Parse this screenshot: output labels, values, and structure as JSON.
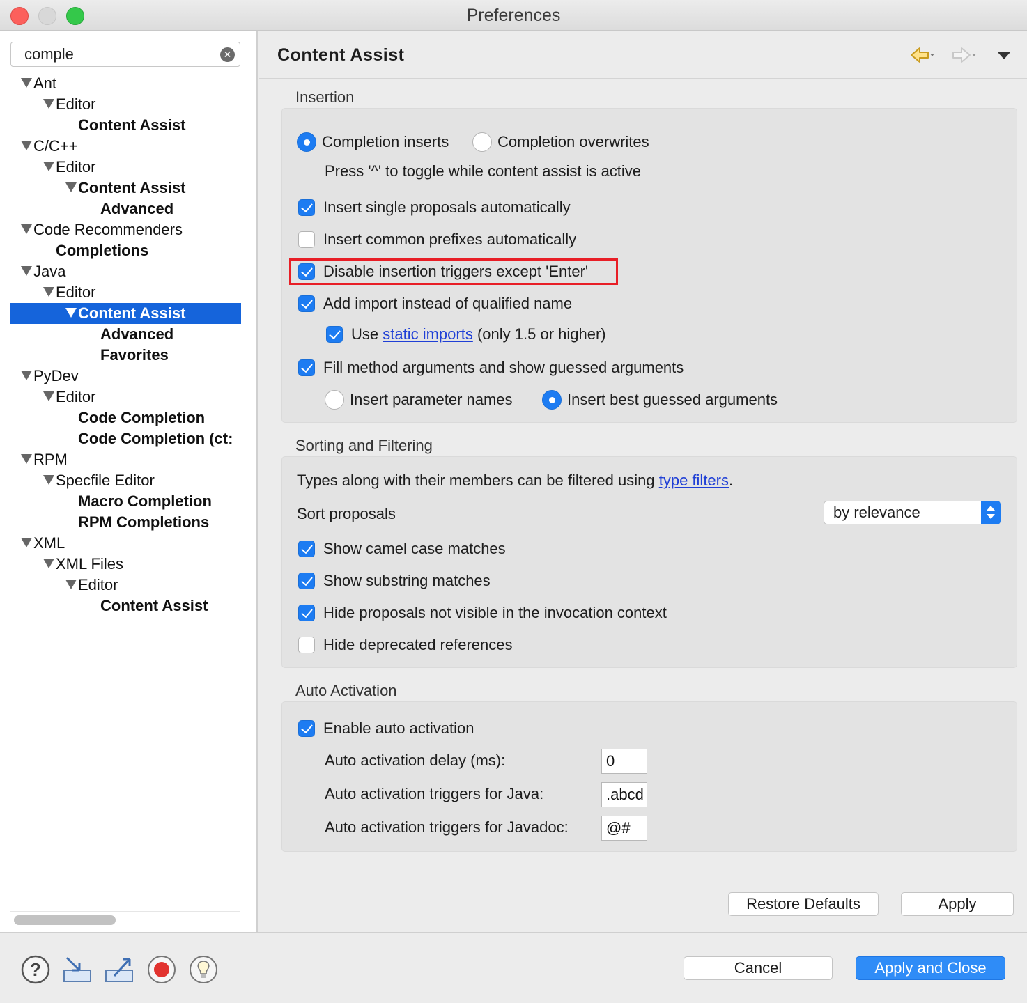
{
  "window": {
    "title": "Preferences"
  },
  "search": {
    "value": "comple",
    "clear_icon": "✕"
  },
  "tree": [
    {
      "label": "Ant",
      "bold": false,
      "expander": true,
      "selected": false
    },
    {
      "label": "Editor",
      "bold": false,
      "expander": true,
      "selected": false
    },
    {
      "label": "Content Assist",
      "bold": true,
      "expander": false,
      "selected": false
    },
    {
      "label": "C/C++",
      "bold": false,
      "expander": true,
      "selected": false
    },
    {
      "label": "Editor",
      "bold": false,
      "expander": true,
      "selected": false
    },
    {
      "label": "Content Assist",
      "bold": true,
      "expander": true,
      "selected": false
    },
    {
      "label": "Advanced",
      "bold": true,
      "expander": false,
      "selected": false
    },
    {
      "label": "Code Recommenders",
      "bold": false,
      "expander": true,
      "selected": false
    },
    {
      "label": "Completions",
      "bold": true,
      "expander": false,
      "selected": false
    },
    {
      "label": "Java",
      "bold": false,
      "expander": true,
      "selected": false
    },
    {
      "label": "Editor",
      "bold": false,
      "expander": true,
      "selected": false
    },
    {
      "label": "Content Assist",
      "bold": true,
      "expander": true,
      "selected": true
    },
    {
      "label": "Advanced",
      "bold": true,
      "expander": false,
      "selected": false
    },
    {
      "label": "Favorites",
      "bold": true,
      "expander": false,
      "selected": false
    },
    {
      "label": "PyDev",
      "bold": false,
      "expander": true,
      "selected": false
    },
    {
      "label": "Editor",
      "bold": false,
      "expander": true,
      "selected": false
    },
    {
      "label": "Code Completion",
      "bold": true,
      "expander": false,
      "selected": false
    },
    {
      "label": "Code Completion (ct:",
      "bold": true,
      "expander": false,
      "selected": false
    },
    {
      "label": "RPM",
      "bold": false,
      "expander": true,
      "selected": false
    },
    {
      "label": "Specfile Editor",
      "bold": false,
      "expander": true,
      "selected": false
    },
    {
      "label": "Macro Completion",
      "bold": true,
      "expander": false,
      "selected": false
    },
    {
      "label": "RPM Completions",
      "bold": true,
      "expander": false,
      "selected": false
    },
    {
      "label": "XML",
      "bold": false,
      "expander": true,
      "selected": false
    },
    {
      "label": "XML Files",
      "bold": false,
      "expander": true,
      "selected": false
    },
    {
      "label": "Editor",
      "bold": false,
      "expander": true,
      "selected": false
    },
    {
      "label": "Content Assist",
      "bold": true,
      "expander": false,
      "selected": false
    }
  ],
  "main": {
    "title": "Content Assist",
    "nav": {
      "back_icon": "arrow-left-icon",
      "forward_icon": "arrow-right-icon",
      "menu_icon": "chevron-down-icon"
    },
    "insertion": {
      "title": "Insertion",
      "radio_inserts": "Completion inserts",
      "radio_overwrites": "Completion overwrites",
      "toggle_hint": "Press '^' to toggle while content assist is active",
      "single_proposals": "Insert single proposals automatically",
      "common_prefixes": "Insert common prefixes automatically",
      "disable_triggers": "Disable insertion triggers except 'Enter'",
      "add_import": "Add import instead of qualified name",
      "use_prefix": "Use",
      "static_imports_link": "static imports",
      "use_suffix": "(only 1.5 or higher)",
      "fill_args": "Fill method arguments and show guessed arguments",
      "param_names": "Insert parameter names",
      "best_guessed": "Insert best guessed arguments"
    },
    "sorting": {
      "title": "Sorting and Filtering",
      "types_text": "Types along with their members can be filtered using",
      "type_filters_link": "type filters",
      "period": ".",
      "sort_label": "Sort proposals",
      "sort_value": "by relevance",
      "camel_case": "Show camel case matches",
      "substring": "Show substring matches",
      "hide_not_visible": "Hide proposals not visible in the invocation context",
      "hide_deprecated": "Hide deprecated references"
    },
    "auto": {
      "title": "Auto Activation",
      "enable": "Enable auto activation",
      "delay_label": "Auto activation delay (ms):",
      "delay_value": "0",
      "java_label": "Auto activation triggers for Java:",
      "java_value": ".abcd",
      "javadoc_label": "Auto activation triggers for Javadoc:",
      "javadoc_value": "@#"
    },
    "restore_defaults": "Restore Defaults",
    "apply": "Apply"
  },
  "footer": {
    "cancel": "Cancel",
    "apply_close": "Apply and Close",
    "icons": [
      "help-icon",
      "import-icon",
      "export-icon",
      "record-icon",
      "lightbulb-icon"
    ]
  },
  "colors": {
    "accent": "#1d7cf2",
    "selection": "#1564db",
    "highlight_box": "#e81e26",
    "link": "#1f3fd6"
  }
}
